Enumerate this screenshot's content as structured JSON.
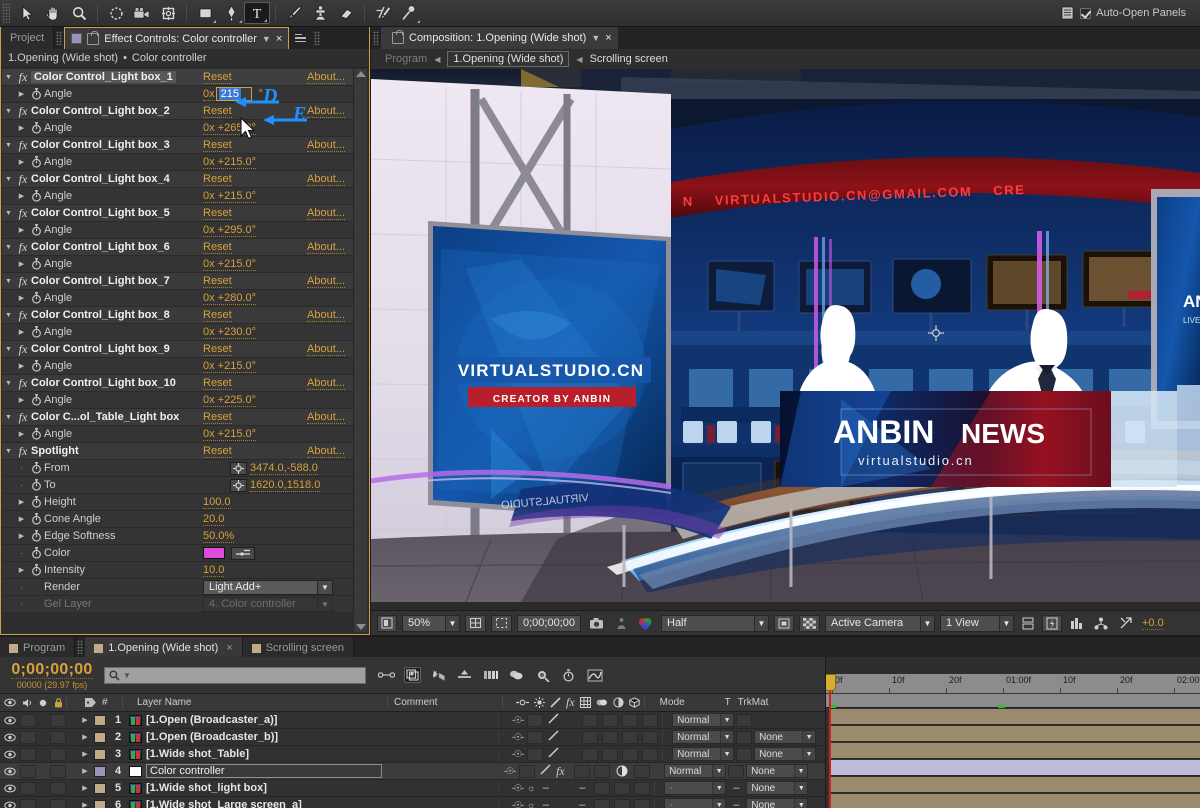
{
  "toolbar": {
    "tools": [
      {
        "name": "selection-tool",
        "sel": false
      },
      {
        "name": "hand-tool",
        "sel": false
      },
      {
        "name": "zoom-tool",
        "sel": false
      },
      {
        "name": "rotation-tool",
        "sel": false
      },
      {
        "name": "camera-tool",
        "sel": false
      },
      {
        "name": "pan-behind-tool",
        "sel": false
      },
      {
        "name": "shape-tool",
        "sel": false
      },
      {
        "name": "pen-tool",
        "sel": false
      },
      {
        "name": "type-tool",
        "sel": true
      },
      {
        "name": "brush-tool",
        "sel": false
      },
      {
        "name": "clone-stamp-tool",
        "sel": false
      },
      {
        "name": "eraser-tool",
        "sel": false
      },
      {
        "name": "roto-brush-tool",
        "sel": false
      },
      {
        "name": "puppet-pin-tool",
        "sel": false
      }
    ],
    "auto_open_panels": "Auto-Open Panels"
  },
  "effect_controls": {
    "tabs": [
      {
        "label": "Project",
        "active": false
      },
      {
        "label": "Effect Controls: Color controller",
        "active": true
      }
    ],
    "breadcrumb_comp": "1.Opening (Wide shot)",
    "breadcrumb_layer": "Color controller",
    "reset_label": "Reset",
    "about_label": "About...",
    "angle_label": "Angle",
    "effects": [
      {
        "name": "Color Control_Light box_1",
        "angle": "0x +215.0°",
        "editing": true,
        "edit_prefix": "0x",
        "edit_value": "215",
        "deg": "°"
      },
      {
        "name": "Color Control_Light box_2",
        "angle": "0x +265.0°",
        "editing": false
      },
      {
        "name": "Color Control_Light box_3",
        "angle": "0x +215.0°",
        "editing": false
      },
      {
        "name": "Color Control_Light box_4",
        "angle": "0x +215.0°",
        "editing": false
      },
      {
        "name": "Color Control_Light box_5",
        "angle": "0x +295.0°",
        "editing": false
      },
      {
        "name": "Color Control_Light box_6",
        "angle": "0x +215.0°",
        "editing": false
      },
      {
        "name": "Color Control_Light box_7",
        "angle": "0x +280.0°",
        "editing": false
      },
      {
        "name": "Color Control_Light box_8",
        "angle": "0x +230.0°",
        "editing": false
      },
      {
        "name": "Color Control_Light box_9",
        "angle": "0x +215.0°",
        "editing": false
      },
      {
        "name": "Color Control_Light box_10",
        "angle": "0x +225.0°",
        "editing": false
      },
      {
        "name": "Color C...ol_Table_Light box",
        "angle": "0x +215.0°",
        "editing": false
      }
    ],
    "spotlight": {
      "name": "Spotlight",
      "params": [
        {
          "label": "From",
          "value": "3474.0,-588.0",
          "type": "point"
        },
        {
          "label": "To",
          "value": "1620.0,1518.0",
          "type": "point"
        },
        {
          "label": "Height",
          "value": "100.0",
          "type": "num"
        },
        {
          "label": "Cone Angle",
          "value": "20.0",
          "type": "num"
        },
        {
          "label": "Edge Softness",
          "value": "50.0%",
          "type": "num"
        },
        {
          "label": "Color",
          "value": "#DD4DDD",
          "type": "color"
        },
        {
          "label": "Intensity",
          "value": "10.0",
          "type": "num"
        },
        {
          "label": "Render",
          "value": "Light Add+",
          "type": "dropdown"
        },
        {
          "label": "Gel Layer",
          "value": "4. Color controller",
          "type": "dropdown-disabled"
        }
      ]
    },
    "annotations": [
      {
        "letter": "D",
        "target": "reset-button"
      },
      {
        "letter": "E",
        "target": "angle-value-field"
      }
    ]
  },
  "composition": {
    "tab_title": "Composition: 1.Opening (Wide shot)",
    "breadcrumb": [
      {
        "label": "Program",
        "style": "dim"
      },
      {
        "label": "1.Opening (Wide shot)",
        "style": "boxed"
      },
      {
        "label": "Scrolling screen",
        "style": "plain"
      }
    ],
    "stage": {
      "left_screen_title": "VIRTUALSTUDIO.CN",
      "left_screen_sub": "CREATOR BY ANBIN",
      "ticker_text": "N    VIRTUALSTUDIO.CN@GMAIL.COM      CRE",
      "desk_title_a": "ANBIN",
      "desk_title_b": "NEWS",
      "desk_subtitle": "virtualstudio.cn",
      "right_panel_a": "ANBIN",
      "right_panel_b": "LIVE NEW"
    },
    "footer": {
      "zoom": "50%",
      "timecode": "0;00;00;00",
      "resolution": "Half",
      "camera": "Active Camera",
      "views": "1 View",
      "exposure": "+0.0"
    }
  },
  "timeline": {
    "tabs": [
      {
        "label": "Program",
        "active": false,
        "closable": false
      },
      {
        "label": "1.Opening (Wide shot)",
        "active": true,
        "closable": true
      },
      {
        "label": "Scrolling screen",
        "active": false,
        "closable": false
      }
    ],
    "current_time": "0;00;00;00",
    "frame_info": "00000 (29.97 fps)",
    "search_placeholder": "",
    "columns": {
      "num": "#",
      "layer_name": "Layer Name",
      "comment": "Comment",
      "mode": "Mode",
      "t": "T",
      "trkmat": "TrkMat"
    },
    "layers": [
      {
        "num": "1",
        "name": "[1.Open (Broadcaster_a)]",
        "mode": "Normal",
        "trkmat": "",
        "selected": false,
        "editing": false,
        "swatch": "#c0ab86",
        "fx": false,
        "has_trkmat": false,
        "is3d": false
      },
      {
        "num": "2",
        "name": "[1.Open (Broadcaster_b)]",
        "mode": "Normal",
        "trkmat": "None",
        "selected": false,
        "editing": false,
        "swatch": "#c0ab86",
        "fx": false,
        "has_trkmat": true,
        "is3d": false
      },
      {
        "num": "3",
        "name": "[1.Wide shot_Table]",
        "mode": "Normal",
        "trkmat": "None",
        "selected": false,
        "editing": false,
        "swatch": "#c0ab86",
        "fx": false,
        "has_trkmat": true,
        "is3d": false
      },
      {
        "num": "4",
        "name": "Color controller",
        "mode": "Normal",
        "trkmat": "None",
        "selected": true,
        "editing": true,
        "swatch": "#9a93b8",
        "fx": true,
        "has_trkmat": true,
        "is3d": false
      },
      {
        "num": "5",
        "name": "[1.Wide shot_light box]",
        "mode": "-",
        "trkmat": "None",
        "selected": false,
        "editing": false,
        "swatch": "#c0ab86",
        "fx": false,
        "has_trkmat": true,
        "is3d": true
      },
      {
        "num": "6",
        "name": "[1.Wide shot_Large screen_a]",
        "mode": "-",
        "trkmat": "None",
        "selected": false,
        "editing": false,
        "swatch": "#c0ab86",
        "fx": false,
        "has_trkmat": true,
        "is3d": true
      }
    ],
    "ruler_ticks": [
      "0f",
      "10f",
      "20f",
      "01:00f",
      "10f",
      "20f",
      "02:00f"
    ],
    "playhead_time": "0;00;00;00"
  }
}
